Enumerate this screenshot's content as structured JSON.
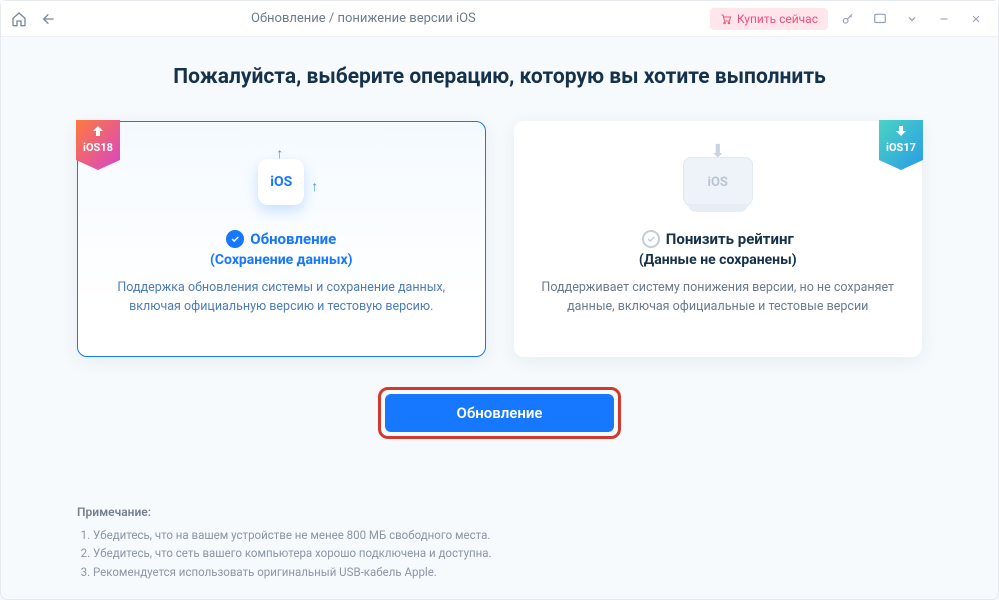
{
  "titlebar": {
    "title": "Обновление / понижение версии iOS",
    "buy": "Купить сейчас"
  },
  "heading": "Пожалуйста, выберите операцию, которую вы хотите выполнить",
  "upgrade": {
    "badge": "iOS18",
    "title": "Обновление",
    "sub": "(Сохранение данных)",
    "desc": "Поддержка обновления системы и сохранение данных, включая официальную версию и тестовую версию.",
    "ios": "iOS"
  },
  "downgrade": {
    "badge": "iOS17",
    "title": "Понизить рейтинг",
    "sub": "(Данные не сохранены)",
    "desc": "Поддерживает систему понижения версии, но не сохраняет данные, включая официальные и тестовые версии",
    "ios": "iOS"
  },
  "action": "Обновление",
  "notes": {
    "title": "Примечание:",
    "items": [
      "Убедитесь, что на вашем устройстве не менее 800 МБ свободного места.",
      "Убедитесь, что сеть вашего компьютера хорошо подключена и доступна.",
      "Рекомендуется использовать оригинальный USB-кабель Apple."
    ]
  }
}
